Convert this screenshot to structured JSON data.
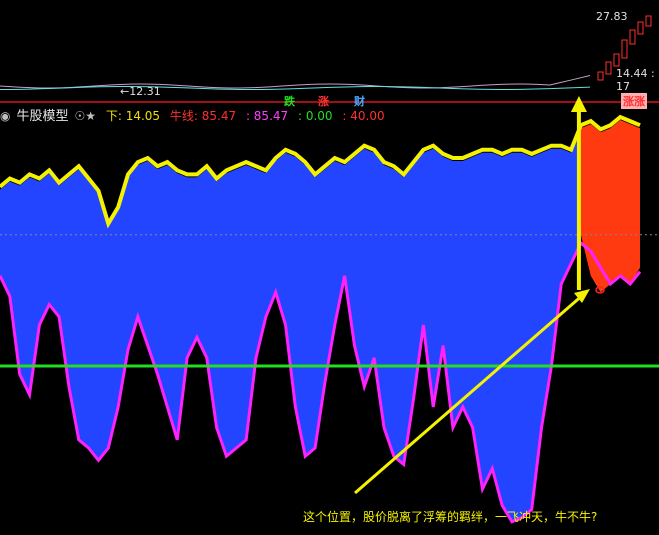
{
  "header": {
    "title": "牛股模型",
    "title_suffix": "☉★",
    "down_label": "下: 14.05",
    "bull_label": "牛线: 85.47",
    "value2": ": 85.47",
    "value3": ": 0.00",
    "value4": ": 40.00"
  },
  "price_panel": {
    "high_label": "27.83",
    "low_label": "12.31",
    "mid_label": "14.44 : 17",
    "signals": {
      "fall": "跌",
      "fall2": "涨",
      "cai": "财",
      "zhang": "涨涨"
    }
  },
  "annotation": "这个位置，股价脱离了浮筹的羁绊，一飞冲天，牛不牛?",
  "colors": {
    "blue_fill": "#2345ff",
    "red_fill": "#ff3a10",
    "yellow_line": "#f5f200",
    "magenta_line": "#ff22ff",
    "green_line": "#22dd22",
    "dark_purple": "#4a1060"
  },
  "chart_data": {
    "type": "area",
    "title": "",
    "xlabel": "",
    "ylabel": "",
    "ylim": [
      0,
      100
    ],
    "reference_lines": [
      {
        "value": 72,
        "style": "dotted",
        "color": "#888888"
      },
      {
        "value": 40,
        "style": "solid",
        "color": "#22dd22"
      }
    ],
    "series": [
      {
        "values": [
          83,
          85,
          84,
          86,
          85,
          87,
          84,
          86,
          88,
          85,
          82,
          74,
          78,
          86,
          89,
          90,
          88,
          89,
          87,
          86,
          86,
          88,
          85,
          87,
          88,
          89,
          88,
          87,
          90,
          92,
          91,
          89,
          86,
          88,
          90,
          89,
          91,
          93,
          92,
          89,
          88,
          86,
          89,
          92,
          93,
          91,
          90,
          90,
          91,
          92,
          92,
          91,
          92,
          92,
          91,
          92,
          93,
          93,
          92,
          98,
          99,
          97,
          98,
          100,
          99,
          98
        ]
      },
      {
        "values": [
          72,
          72,
          72,
          72,
          72,
          72,
          72,
          72,
          72,
          72,
          72,
          72,
          72,
          72,
          72,
          72,
          72,
          72,
          72,
          72,
          72,
          72,
          72,
          72,
          72,
          72,
          72,
          72,
          72,
          72,
          72,
          72,
          72,
          72,
          72,
          72,
          72,
          72,
          72,
          72,
          72,
          72,
          72,
          72,
          72,
          72,
          72,
          72,
          72,
          72,
          72,
          72,
          72,
          72,
          72,
          72,
          72,
          72,
          72,
          72,
          62,
          58,
          60,
          62,
          60,
          64
        ]
      },
      {
        "values": [
          62,
          57,
          38,
          33,
          50,
          55,
          52,
          35,
          22,
          20,
          17,
          20,
          30,
          44,
          52,
          45,
          38,
          30,
          22,
          42,
          47,
          42,
          25,
          18,
          20,
          22,
          42,
          52,
          58,
          50,
          30,
          18,
          20,
          36,
          50,
          62,
          45,
          35,
          42,
          25,
          18,
          16,
          32,
          50,
          30,
          45,
          25,
          30,
          25,
          10,
          15,
          6,
          2,
          3,
          5,
          25,
          40,
          60,
          65,
          70,
          68,
          64,
          60,
          62,
          60,
          63
        ]
      }
    ]
  }
}
